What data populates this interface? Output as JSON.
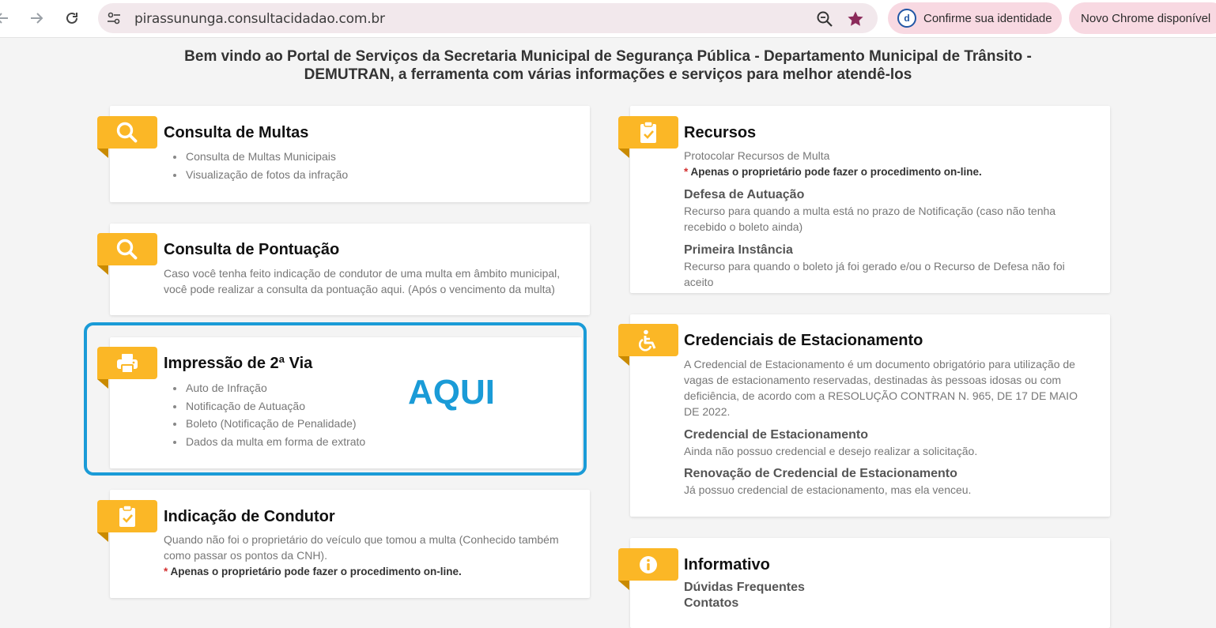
{
  "browser": {
    "url": "pirassununga.consultacidadao.com.br",
    "identity_pill": "Confirme sua identidade",
    "identity_avatar": "d",
    "chrome_pill": "Novo Chrome disponível"
  },
  "welcome": "Bem vindo ao Portal de Serviços da Secretaria Municipal de Segurança Pública - Departamento Municipal de Trânsito - DEMUTRAN, a ferramenta com várias informações e serviços para melhor atendê-los",
  "cards": {
    "multas": {
      "title": "Consulta de Multas",
      "icon": "search-icon",
      "items": [
        "Consulta de Multas Municipais",
        "Visualização de fotos da infração"
      ]
    },
    "pontuacao": {
      "title": "Consulta de Pontuação",
      "icon": "search-icon",
      "desc": "Caso você tenha feito indicação de condutor de uma multa em âmbito municipal, você pode realizar a consulta da pontuação aqui. (Após o vencimento da multa)"
    },
    "impressao": {
      "title": "Impressão de 2ª Via",
      "icon": "printer-icon",
      "items": [
        "Auto de Infração",
        "Notificação de Autuação",
        "Boleto (Notificação de Penalidade)",
        "Dados da multa em forma de extrato"
      ]
    },
    "indicacao": {
      "title": "Indicação de Condutor",
      "icon": "clipboard-check-icon",
      "desc": "Quando não foi o proprietário do veículo que tomou a multa (Conhecido também como passar os pontos da CNH).",
      "note_mark": "*",
      "note": "Apenas o proprietário pode fazer o procedimento on-line."
    },
    "recursos": {
      "title": "Recursos",
      "icon": "clipboard-check-icon",
      "desc": "Protocolar Recursos de Multa",
      "note_mark": "*",
      "note": "Apenas o proprietário pode fazer o procedimento on-line.",
      "defesa_title": "Defesa de Autuação",
      "defesa_desc": "Recurso para quando a multa está no prazo de Notificação (caso não tenha recebido o boleto ainda)",
      "primeira_title": "Primeira Instância",
      "primeira_desc": "Recurso para quando o boleto já foi gerado e/ou o Recurso de Defesa não foi aceito"
    },
    "credenciais": {
      "title": "Credenciais de Estacionamento",
      "icon": "wheelchair-icon",
      "desc": "A Credencial de Estacionamento é um documento obrigatório para utilização de vagas de estacionamento reservadas, destinadas às pessoas idosas ou com deficiência, de acordo com a RESOLUÇÃO CONTRAN N. 965, DE 17 DE MAIO DE 2022.",
      "credencial_title": "Credencial de Estacionamento",
      "credencial_desc": "Ainda não possuo credencial e desejo realizar a solicitação.",
      "renovacao_title": "Renovação de Credencial de Estacionamento",
      "renovacao_desc": "Já possuo credencial de estacionamento, mas ela venceu."
    },
    "informativo": {
      "title": "Informativo",
      "icon": "info-icon",
      "links": [
        "Dúvidas Frequentes",
        "Contatos"
      ]
    }
  },
  "annotation": {
    "label": "AQUI",
    "color": "#1a9bd7"
  },
  "colors": {
    "badge": "#fbb726",
    "note_asterisk": "#d32f2f"
  }
}
